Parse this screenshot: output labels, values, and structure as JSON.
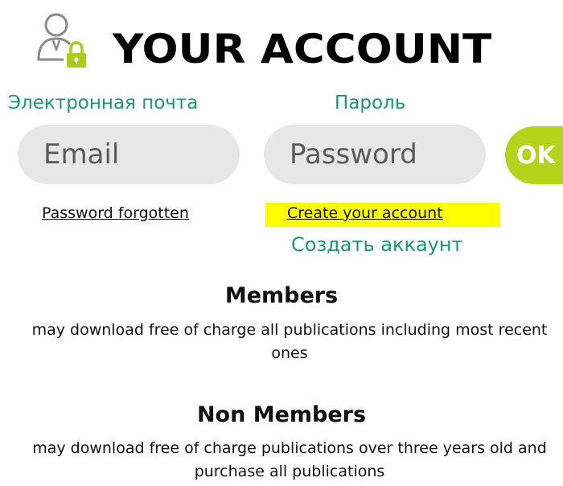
{
  "header": {
    "title": "YOUR ACCOUNT",
    "icon": "user-lock-icon",
    "icon_color": "#aacc1a"
  },
  "login": {
    "email_label": "Электронная почта",
    "password_label": "Пароль",
    "email_placeholder": "Email",
    "password_placeholder": "Password",
    "ok_label": "OK",
    "ok_color": "#b5d31a",
    "label_color": "#1a9a6a"
  },
  "links": {
    "password_forgotten": "Password forgotten",
    "create_account": "Create your account",
    "create_account_ru": "Создать аккаунт",
    "highlight_color": "#ffff00"
  },
  "members": {
    "title": "Members",
    "text": "may download free of charge all publications including most recent ones"
  },
  "non_members": {
    "title": "Non Members",
    "text": "may download free of charge publications over three years old and purchase all publications"
  }
}
